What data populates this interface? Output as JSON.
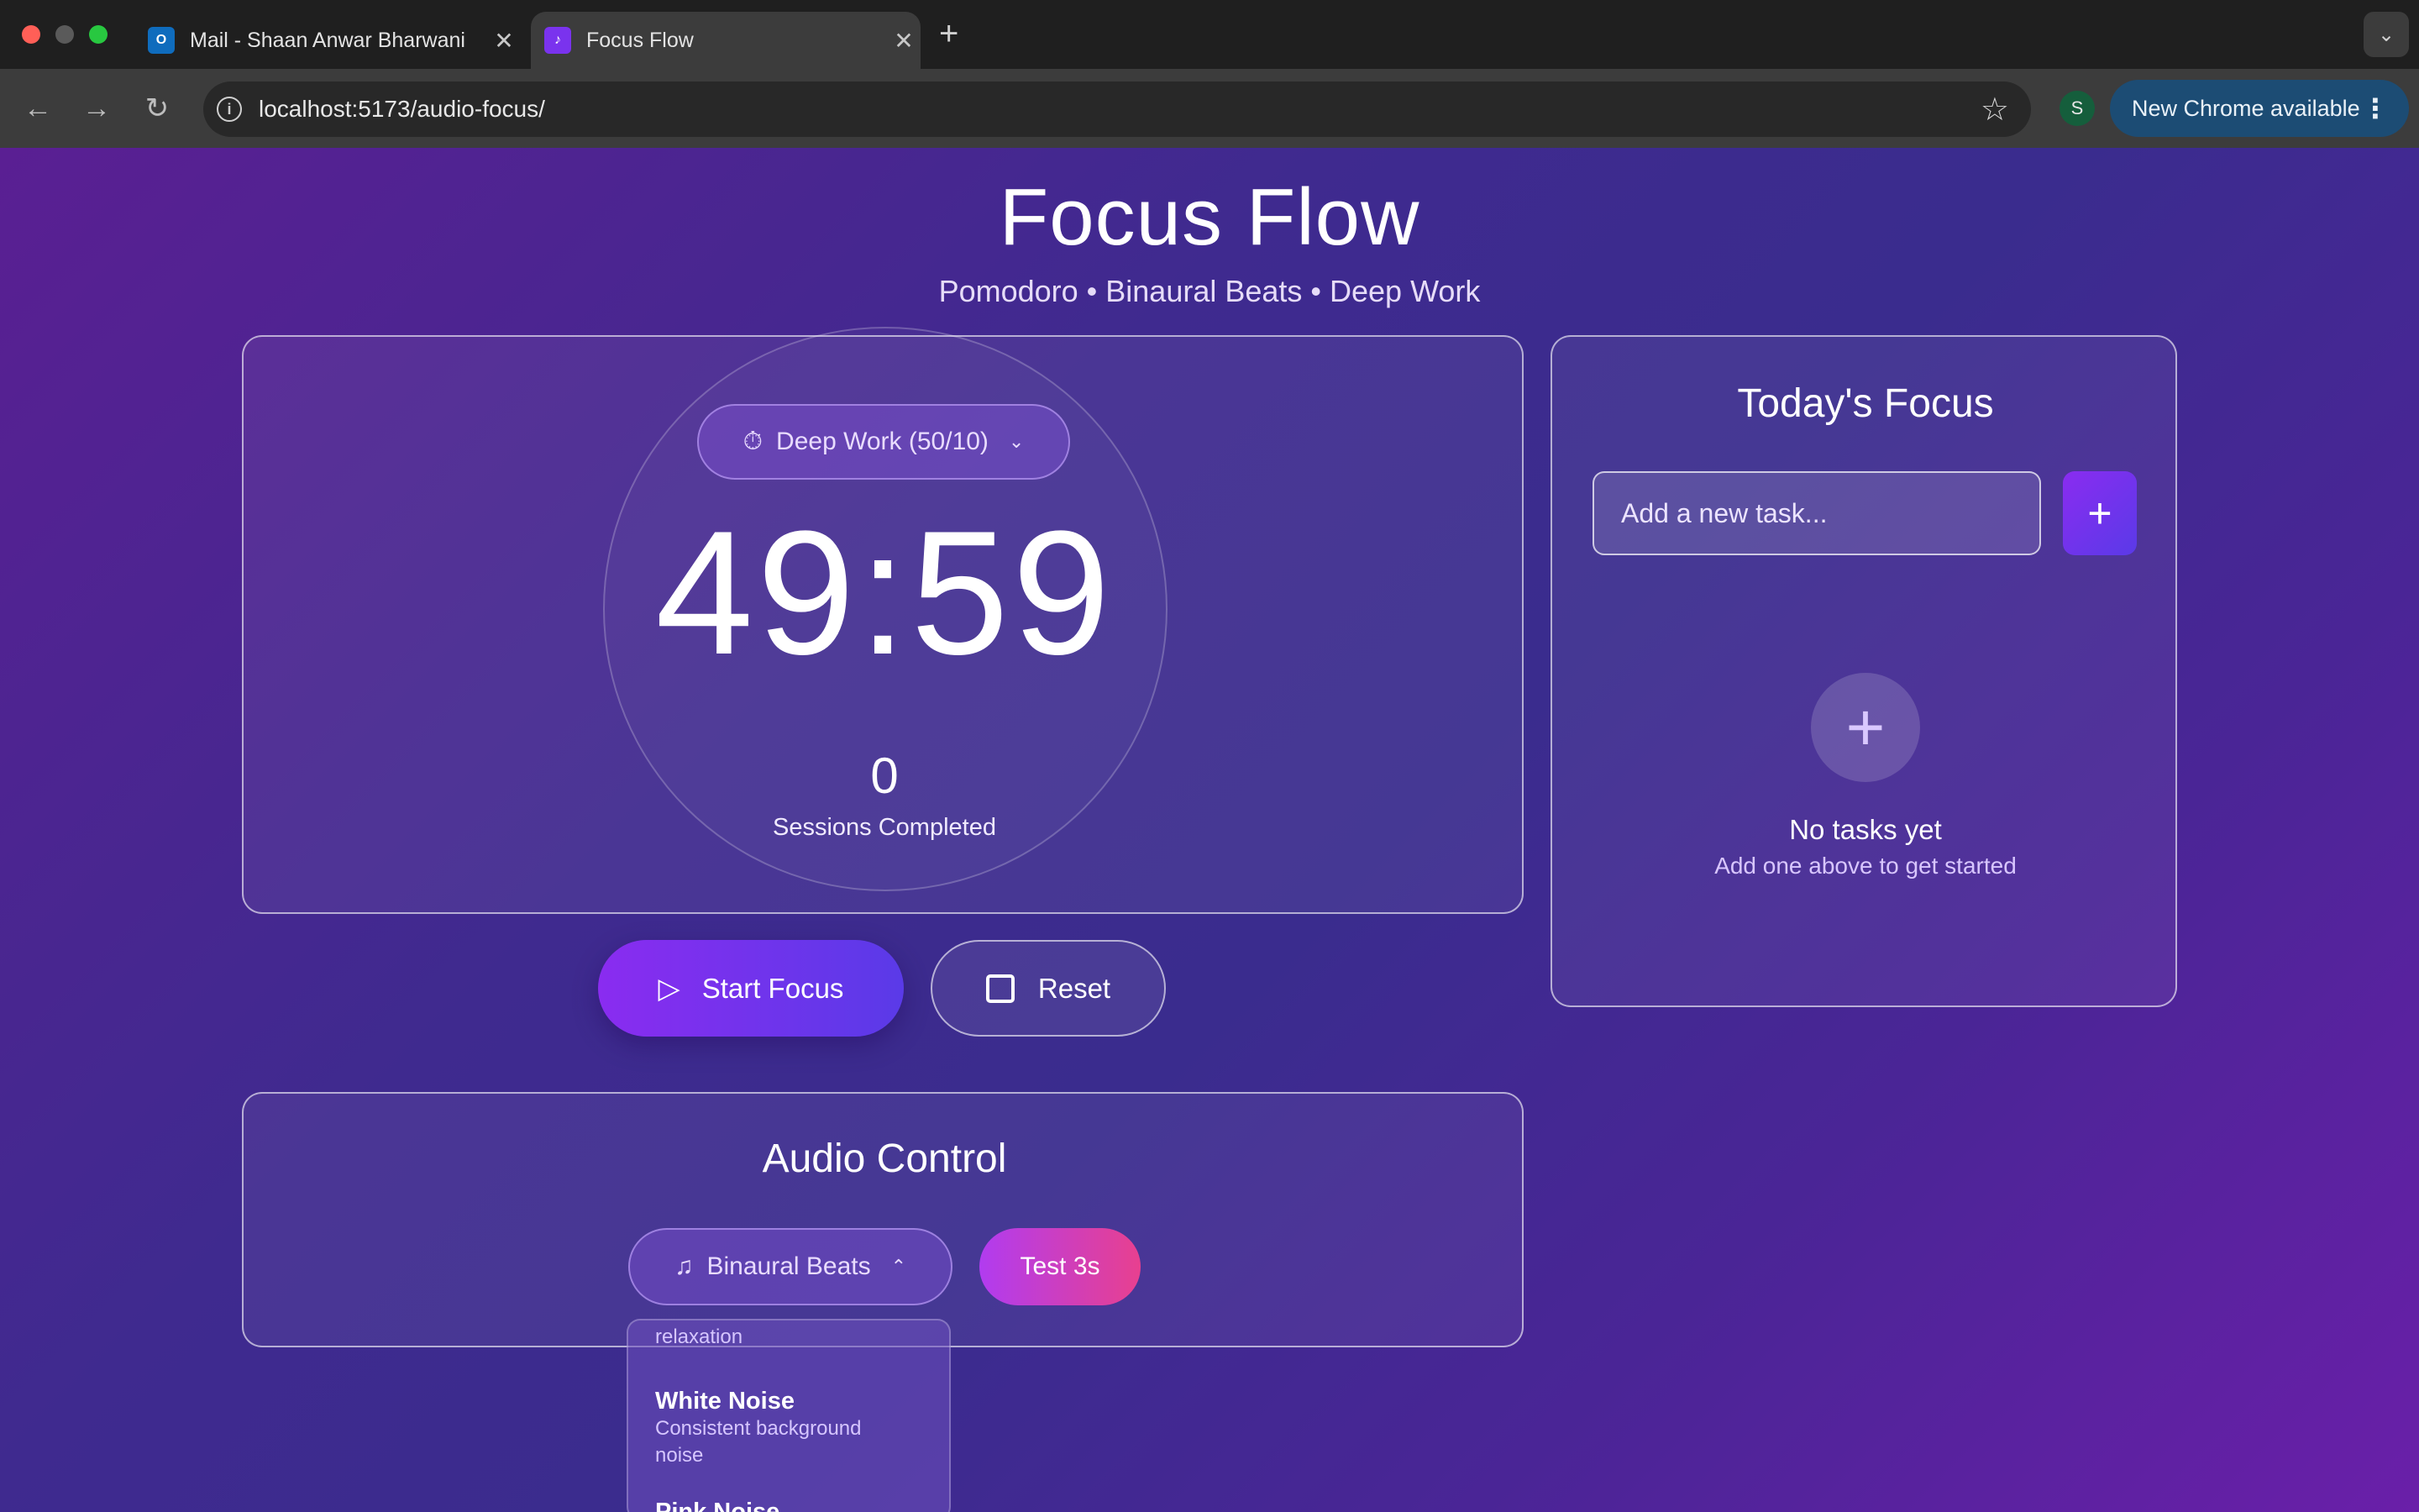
{
  "browser": {
    "tabs": [
      {
        "title": "Mail - Shaan Anwar Bharwani",
        "active": false
      },
      {
        "title": "Focus Flow",
        "active": true
      }
    ],
    "url": "localhost:5173/audio-focus/",
    "profile_initial": "S",
    "update_label": "New Chrome available"
  },
  "app": {
    "title": "Focus Flow",
    "subtitle": "Pomodoro • Binaural Beats • Deep Work"
  },
  "timer": {
    "mode_label": "Deep Work (50/10)",
    "time": "49:59",
    "sessions_count": "0",
    "sessions_label": "Sessions Completed"
  },
  "controls": {
    "start_label": "Start Focus",
    "reset_label": "Reset"
  },
  "focus": {
    "title": "Today's Focus",
    "input_placeholder": "Add a new task...",
    "add_label": "+",
    "empty_title": "No tasks yet",
    "empty_subtitle": "Add one above to get started"
  },
  "audio": {
    "title": "Audio Control",
    "selected": "Binaural Beats",
    "test_label": "Test 3s",
    "dropdown": [
      {
        "name": "",
        "desc": "relaxation",
        "partial": true
      },
      {
        "name": "White Noise",
        "desc_lines": [
          "Consistent background",
          "noise"
        ]
      },
      {
        "name": "Pink Noise",
        "partial": true
      }
    ]
  },
  "colors": {
    "accent": "#7a33ee",
    "test_button": "#e8408f",
    "background": "#3f2a8f"
  }
}
